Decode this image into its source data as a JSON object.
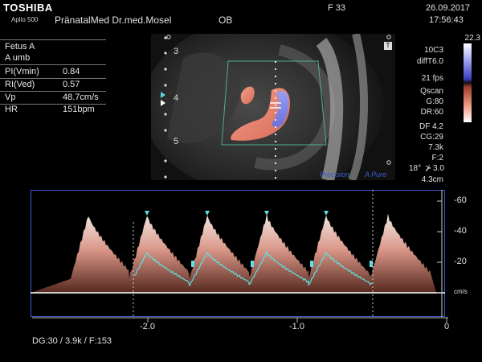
{
  "header": {
    "brand": "TOSHIBA",
    "model": "Aplio 500",
    "clinic": "PränatalMed Dr.med.Mosel",
    "mode": "OB",
    "frame": "F 33",
    "date": "26.09.2017",
    "time": "17:56:43"
  },
  "measurements": {
    "label1": "Fetus A",
    "label2": "A umb",
    "rows": [
      {
        "name": "PI(Vmin)",
        "value": "0.84"
      },
      {
        "name": "RI(Ved)",
        "value": "0.57"
      },
      {
        "name": "Vp",
        "value": "48.7cm/s"
      },
      {
        "name": "HR",
        "value": "151bpm"
      }
    ]
  },
  "image": {
    "depth_marks": [
      "3",
      "4",
      "5"
    ],
    "watermark_precision": "Precision",
    "watermark_apure": "A Pure",
    "badge": "T"
  },
  "params": {
    "probe": "10C3",
    "filter": "diffT6.0",
    "fps": "21 fps",
    "qscan": "Qscan",
    "gain": "G:80",
    "dr": "DR:60",
    "df": "DF 4.2",
    "cg": "CG:29",
    "prf": "7.3k",
    "f": "F:2",
    "angle_label": "18°",
    "angle_value": "3.0",
    "depth": "4.3cm",
    "scale_top": "22.3"
  },
  "spectral": {
    "y_ticks": [
      "-60",
      "-40",
      "-20"
    ],
    "unit": "cm/s",
    "x_ticks": [
      "-2.0",
      "-1.0",
      "0"
    ]
  },
  "footer": {
    "info": "DG:30  / 3.9k  / F:153"
  },
  "colors": {
    "doppler_red": "#e8806a",
    "doppler_blue": "#7d82e0",
    "trace_cyan": "#5fe0e0",
    "frame_blue": "#3a59c8"
  }
}
